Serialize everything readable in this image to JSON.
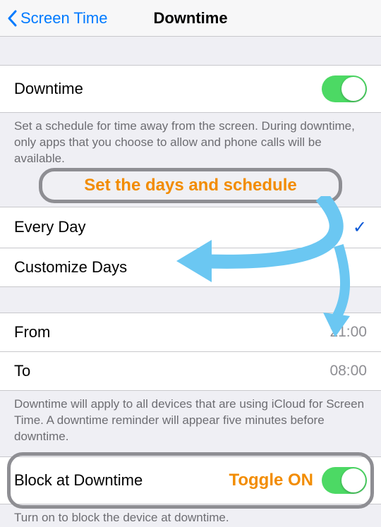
{
  "nav": {
    "back_label": "Screen Time",
    "title": "Downtime"
  },
  "section1": {
    "downtime_label": "Downtime",
    "downtime_on": true,
    "footer": "Set a schedule for time away from the screen. During downtime, only apps that you choose to allow and phone calls will be available."
  },
  "annotations": {
    "schedule_callout": "Set the days and schedule",
    "toggle_callout": "Toggle ON"
  },
  "schedule": {
    "every_day_label": "Every Day",
    "every_day_selected": true,
    "customize_label": "Customize Days"
  },
  "time": {
    "from_label": "From",
    "from_value": "21:00",
    "to_label": "To",
    "to_value": "08:00"
  },
  "footer2": "Downtime will apply to all devices that are using iCloud for Screen Time. A downtime reminder will appear five minutes before downtime.",
  "block": {
    "label": "Block at Downtime",
    "on": true,
    "footer": "Turn on to block the device at downtime."
  }
}
